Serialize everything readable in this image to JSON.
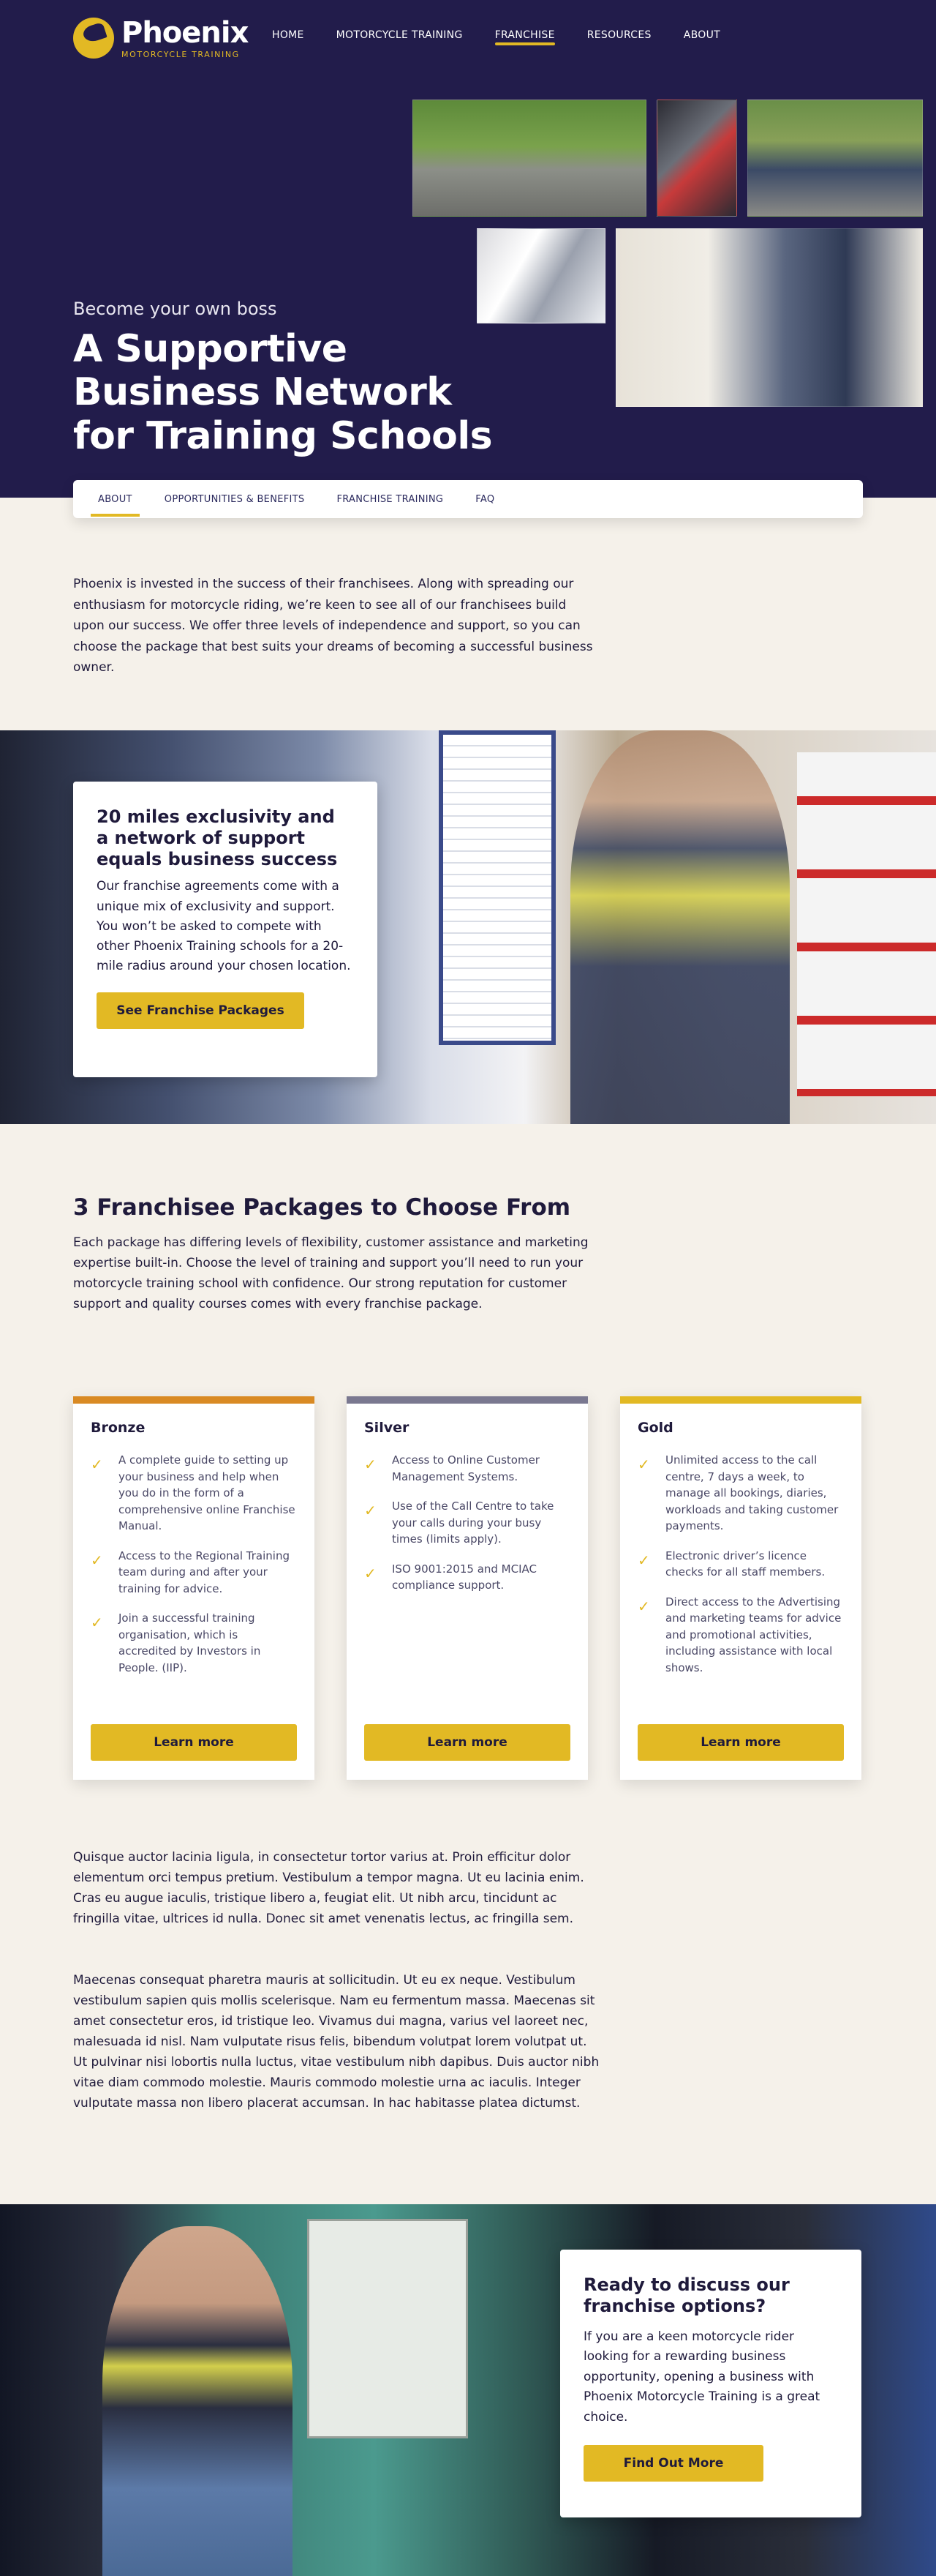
{
  "brand": {
    "name": "Phoenix",
    "tagline": "MOTORCYCLE TRAINING",
    "accent": "#e2b924",
    "navy": "#221c4b"
  },
  "nav": {
    "items": [
      "HOME",
      "MOTORCYCLE TRAINING",
      "FRANCHISE",
      "RESOURCES",
      "ABOUT"
    ],
    "active": "FRANCHISE"
  },
  "hero": {
    "kicker": "Become your own boss",
    "title": "A Supportive Business Network for Training Schools"
  },
  "subnav": {
    "items": [
      "ABOUT",
      "OPPORTUNITIES & BENEFITS",
      "FRANCHISE TRAINING",
      "FAQ"
    ],
    "active": "ABOUT"
  },
  "intro": "Phoenix is invested in the success of their franchisees. Along with spreading our enthusiasm for motorcycle riding, we’re keen to see all of our franchisees build upon our success. We offer three levels of independence and support, so you can choose the package that best suits your dreams of becoming a successful business owner.",
  "exclusivity": {
    "title": "20 miles exclusivity and a network of support equals business success",
    "body": "Our franchise agreements come with a unique mix of exclusivity and support. You won’t be asked to compete with other Phoenix Training schools for a 20-mile radius around your chosen location.",
    "button": "See Franchise Packages"
  },
  "packages": {
    "title": "3 Franchisee Packages to Choose From",
    "intro": "Each package has differing levels of flexibility, customer assistance and marketing expertise built-in. Choose the level of training and support you’ll need to run your motorcycle training school with confidence. Our strong reputation for customer support and quality courses comes with every franchise package.",
    "items": [
      {
        "name": "Bronze",
        "color": "#d98a24",
        "button": "Learn more",
        "features": [
          "A complete guide to setting up your business and help when you do in the form of a comprehensive online Franchise Manual.",
          "Access to the Regional Training team during and after your training for advice.",
          "Join a successful training organisation, which is accredited by Investors in People. (IIP)."
        ]
      },
      {
        "name": "Silver",
        "color": "#7a7890",
        "button": "Learn more",
        "features": [
          "Access to Online Customer Management Systems.",
          "Use of the Call Centre to take your calls during your busy times (limits apply).",
          "ISO 9001:2015 and MCIAC compliance support."
        ]
      },
      {
        "name": "Gold",
        "color": "#e2b924",
        "button": "Learn more",
        "features": [
          "Unlimited access to the call centre, 7 days a week, to manage all bookings, diaries, workloads and taking customer payments.",
          "Electronic driver’s licence checks for all staff members.",
          "Direct access to the Advertising and marketing teams for advice and promotional activities, including assistance with local shows."
        ]
      }
    ]
  },
  "lorem": [
    "Quisque auctor lacinia ligula, in consectetur tortor varius at. Proin efficitur dolor elementum orci tempus pretium. Vestibulum a tempor magna. Ut eu lacinia enim. Cras eu augue iaculis, tristique libero a, feugiat elit. Ut nibh arcu, tincidunt ac fringilla vitae, ultrices id nulla. Donec sit amet venenatis lectus, ac fringilla sem.",
    "Maecenas consequat pharetra mauris at sollicitudin. Ut eu ex neque. Vestibulum vestibulum sapien quis mollis scelerisque. Nam eu fermentum massa. Maecenas sit amet consectetur eros, id tristique leo. Vivamus dui magna, varius vel laoreet nec, malesuada id nisl. Nam vulputate risus felis, bibendum volutpat lorem volutpat ut. Ut pulvinar nisi lobortis nulla luctus, vitae vestibulum nibh dapibus. Duis auctor nibh vitae diam commodo molestie. Mauris commodo molestie urna ac iaculis. Integer vulputate massa non libero placerat accumsan. In hac habitasse platea dictumst."
  ],
  "cta": {
    "title": "Ready to discuss our franchise options?",
    "body": "If you are a keen motorcycle rider looking for a rewarding business opportunity, opening a business with Phoenix Motorcycle Training is a great choice.",
    "button": "Find Out More"
  }
}
